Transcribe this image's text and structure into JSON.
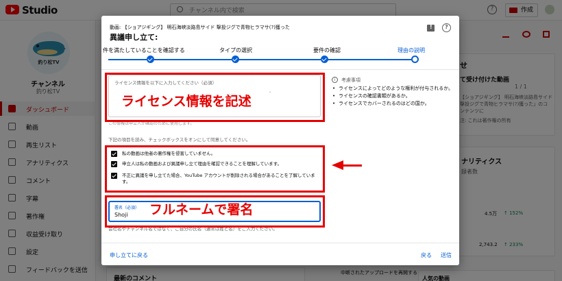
{
  "topbar": {
    "studio_label": "Studio",
    "search_placeholder": "チャンネル内で検索",
    "help_label": "?",
    "create_label": "作成"
  },
  "sidebar": {
    "logo_text": "釣り松TV",
    "channel_heading": "チャンネル",
    "channel_name": "釣り松TV",
    "items": [
      {
        "label": "ダッシュボード",
        "icon": "dashboard-icon",
        "active": true
      },
      {
        "label": "動画",
        "icon": "video-icon"
      },
      {
        "label": "再生リスト",
        "icon": "playlist-icon"
      },
      {
        "label": "アナリティクス",
        "icon": "analytics-icon"
      },
      {
        "label": "コメント",
        "icon": "comment-icon"
      },
      {
        "label": "字幕",
        "icon": "subtitles-icon"
      },
      {
        "label": "著作権",
        "icon": "copyright-icon"
      },
      {
        "label": "収益受け取り",
        "icon": "monetization-icon"
      },
      {
        "label": "設定",
        "icon": "settings-icon"
      },
      {
        "label": "フィードバックを送信",
        "icon": "feedback-icon"
      }
    ]
  },
  "background": {
    "right_card_title": "せ",
    "received_video": "て受け付けた動画",
    "pager": "1 / 1",
    "video_info": "【ショアジギング】 明石海峡淡路島サイド 撃投ジグで青物ヒラマサ(?)獲った」のコンテンツに",
    "note": "注: これは著作権の所有",
    "analytics": "ナリティクス",
    "subscribers": "録者数",
    "stat1_value": "4.5万",
    "stat1_change": "↑ 152%",
    "stat2_value": "2,743.2",
    "stat2_change": "↑ 233%",
    "resume_upload": "中断されたアップロードを再開する",
    "latest_comments": "最新のコメント",
    "popular": "人気の動画"
  },
  "dialog": {
    "video_title": "動画: 【ショアジギング】 明石海峡淡路島サイド 撃投ジグで青物ヒラマサ(?)獲った",
    "heading": "異議申し立て:",
    "steps": [
      {
        "label": "件を満たしていることを確認する",
        "done": true
      },
      {
        "label": "タイプの選択",
        "done": true
      },
      {
        "label": "要件の確認",
        "done": true
      },
      {
        "label": "理由の説明",
        "current": true
      }
    ],
    "license_field_label": "ライセンス情報を以下に入力してください（必須）",
    "license_field_dot": "・",
    "license_help": "この情報は申立人が確認のために使用します。",
    "considerations_title": "考慮事項",
    "considerations": [
      "ライセンスによってどのような権利が付与されるか。",
      "ライセンスの確認書類があるか。",
      "ライセンスでカバーされるのはどの国か。"
    ],
    "checkbox_instruction": "下記の項目を読み、チェックボックスをオンにして同意してください。",
    "checkboxes": [
      "私の動画は他者の著作権を侵害していません。",
      "申立人は私の動画および異議申し立て理由を確認できることを理解しています。",
      "不正に異議を申し立てた場合、YouTube アカウントが削除される場合があることを了解しています。"
    ],
    "signature_label": "署名（必須）",
    "signature_value": "Shoji",
    "signature_help": "会社名やチャンネル名ではなく、ご自分の氏名（通常は姓と名）をご入力ください。",
    "back_to_claim": "申し立てに戻る",
    "back_button": "戻る",
    "submit_button": "送信"
  },
  "annotations": {
    "license_note": "ライセンス情報を記述",
    "check_note_line1": "全ての項目を",
    "check_note_line2": "チェック",
    "signature_note": "フルネームで署名",
    "color": "#e50000"
  }
}
